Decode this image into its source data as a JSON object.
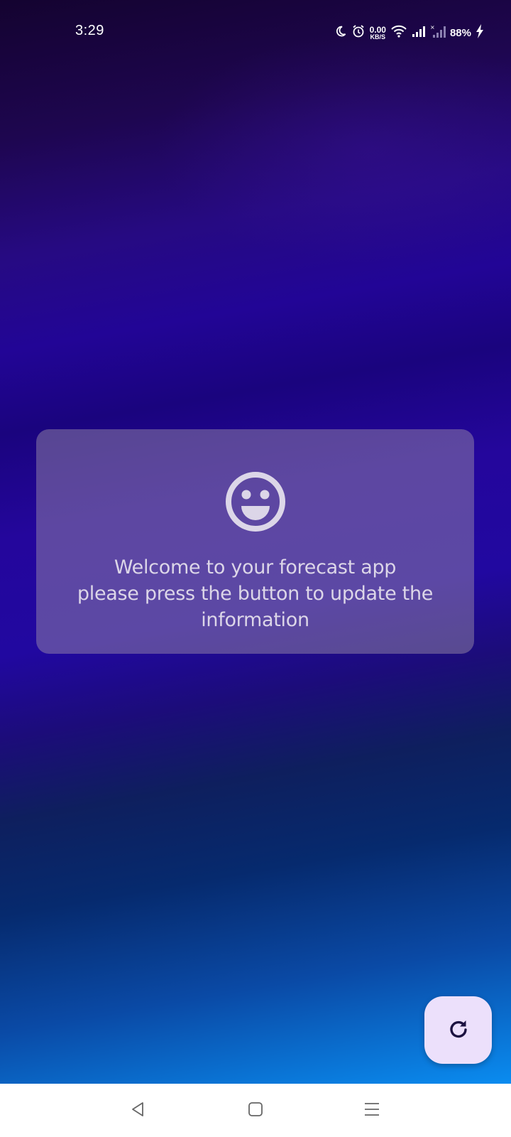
{
  "status_bar": {
    "time": "3:29",
    "net_speed_value": "0.00",
    "net_speed_unit": "KB/S",
    "battery": "88%",
    "icons": [
      "moon-icon",
      "alarm-icon",
      "wifi-icon",
      "signal-icon",
      "signal-no-service-icon",
      "charging-bolt-icon"
    ]
  },
  "welcome": {
    "icon": "smiley-icon",
    "line1": "Welcome to your forecast app",
    "line2": "please press the button to update the",
    "line3": "information"
  },
  "fab": {
    "icon": "refresh-icon"
  },
  "nav_bar": {
    "icons": [
      "back-icon",
      "home-icon",
      "recents-icon"
    ]
  },
  "colors": {
    "fab_bg": "#ece0fb",
    "card_text": "#dcd6e8",
    "gradient_top": "#140330",
    "gradient_bottom": "#0a8cf0"
  }
}
